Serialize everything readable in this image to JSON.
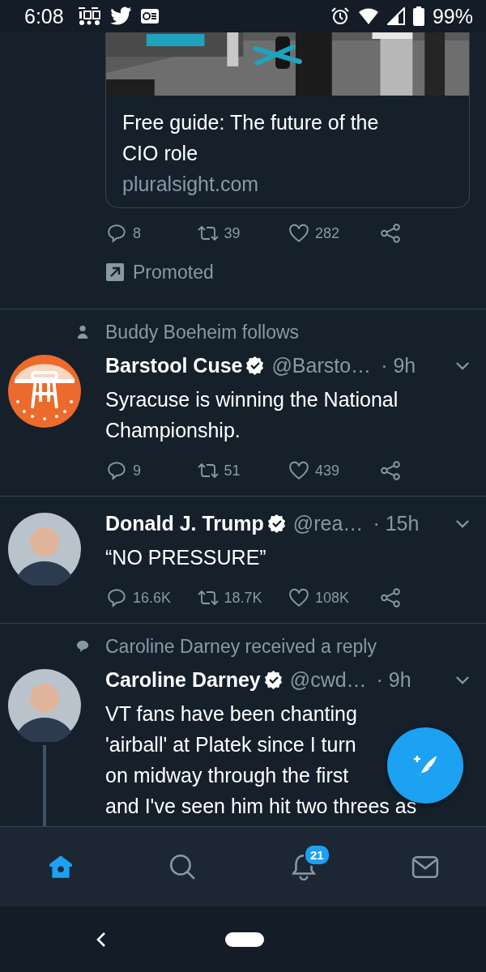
{
  "status_bar": {
    "time": "6:08",
    "battery": "99%"
  },
  "promoted_tweet": {
    "card_title": "Free guide: The future of the CIO role",
    "card_domain": "pluralsight.com",
    "actions": {
      "replies": "8",
      "retweets": "39",
      "likes": "282"
    },
    "promoted_label": "Promoted"
  },
  "tweets": [
    {
      "context": {
        "kind": "follow",
        "text": "Buddy Boeheim follows"
      },
      "avatar": {
        "kind": "logo"
      },
      "name": "Barstool Cuse",
      "verified": true,
      "handle": "@Barsto…",
      "time": "· 9h",
      "text_lines": [
        "Syracuse is winning the National",
        "Championship."
      ],
      "actions": {
        "replies": "9",
        "retweets": "51",
        "likes": "439"
      },
      "thread": false
    },
    {
      "avatar": {
        "kind": "person"
      },
      "name": "Donald J. Trump",
      "verified": true,
      "handle": "@rea…",
      "time": "· 15h",
      "text_lines": [
        "“NO PRESSURE”"
      ],
      "actions": {
        "replies": "16.6K",
        "retweets": "18.7K",
        "likes": "108K"
      },
      "thread": false
    },
    {
      "context": {
        "kind": "reply",
        "text": "Caroline Darney received a reply"
      },
      "avatar": {
        "kind": "person"
      },
      "name": "Caroline Darney",
      "verified": true,
      "handle": "@cwd…",
      "time": "· 9h",
      "text_lines": [
        "VT fans have been chanting",
        "'airball' at Platek since I turn",
        "on midway through the first",
        "and I've seen him hit two threes as"
      ],
      "thread": true
    }
  ],
  "bottom_nav": [
    {
      "kind": "home",
      "selected": true
    },
    {
      "kind": "search",
      "selected": false
    },
    {
      "kind": "notifications",
      "selected": false,
      "badge": "21"
    },
    {
      "kind": "messages",
      "selected": false
    }
  ]
}
